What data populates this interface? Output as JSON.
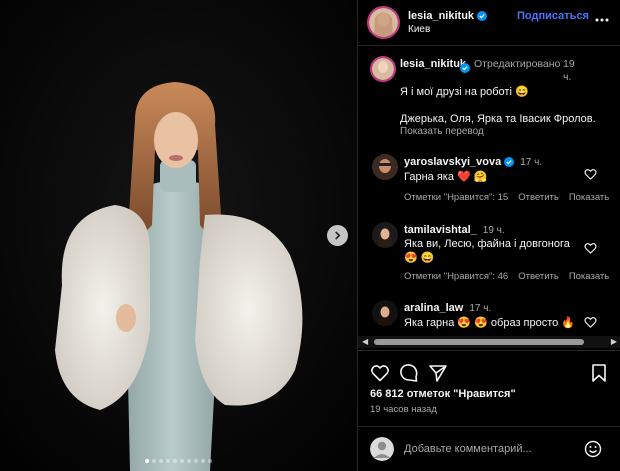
{
  "header": {
    "username": "lesia_nikituk",
    "location": "Киев",
    "follow_label": "Подписаться",
    "more_icon": "more-icon"
  },
  "caption": {
    "username": "lesia_nikituk",
    "edited_label": "Отредактировано",
    "time": "19 ч.",
    "text_line1": "Я і мої друзі на роботі 😄",
    "text_line2": "Джерька, Оля, Ярка та Івасик Фролов.",
    "translate_label": "Показать перевод"
  },
  "comments": [
    {
      "username": "yaroslavskyi_vova",
      "verified": true,
      "time": "17 ч.",
      "text": "Гарна яка ❤️ 🤗",
      "likes_label": "Отметки \"Нравится\": 15",
      "reply_label": "Ответить",
      "show_label": "Показать"
    },
    {
      "username": "tamilavishtal_",
      "verified": false,
      "time": "19 ч.",
      "text": "Яка ви, Лесю, файна і довгонога",
      "text2": "😍 😄",
      "likes_label": "Отметки \"Нравится\": 46",
      "reply_label": "Ответить",
      "show_label": "Показать"
    },
    {
      "username": "aralina_law",
      "verified": false,
      "time": "17 ч.",
      "text": "Яка гарна 😍 😍 образ просто 🔥",
      "likes_label": "",
      "reply_label": "",
      "show_label": ""
    }
  ],
  "post": {
    "likes": "66 812 отметок \"Нравится\"",
    "time_ago": "19 часов назад"
  },
  "add_comment": {
    "placeholder": "Добавьте комментарий..."
  },
  "carousel": {
    "count": 10,
    "active_index": 0
  },
  "colors": {
    "accent": "#4b74ff",
    "background": "#000000",
    "muted": "#a8a8a8",
    "verified": "#0095f6"
  }
}
